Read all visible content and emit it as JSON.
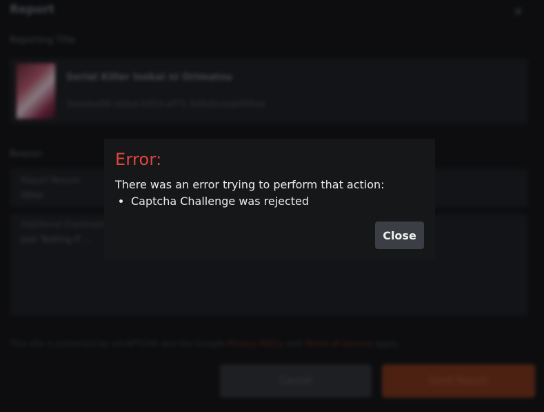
{
  "background": {
    "title": "Report",
    "close_glyph": "×",
    "reporting_title_label": "Reporting Title",
    "series": {
      "name": "Serial Killer Isekai ni Orimatsu",
      "id": "3eeebe00-d2bd-4353-af71-5d5dbcbab0f4ea"
    },
    "reason_label": "Reason",
    "report_reason_label": "Report Reason",
    "report_reason_value": "Other",
    "additional_label": "Additional Explanation",
    "additional_value": "Just Testing If ...",
    "footer": {
      "prefix": "This site is protected by reCAPTCHA and the Google",
      "privacy_link": "Privacy Policy",
      "and": "and",
      "terms_link": "Terms of Service",
      "suffix": "apply."
    },
    "cancel_label": "Cancel",
    "send_label": "Send Report"
  },
  "dialog": {
    "title": "Error:",
    "message": "There was an error trying to perform that action:",
    "errors": [
      "Captcha Challenge was rejected"
    ],
    "close_label": "Close"
  },
  "colors": {
    "error_title": "#e2443f",
    "send_button": "#e0552a",
    "close_button": "#3b3e44"
  }
}
